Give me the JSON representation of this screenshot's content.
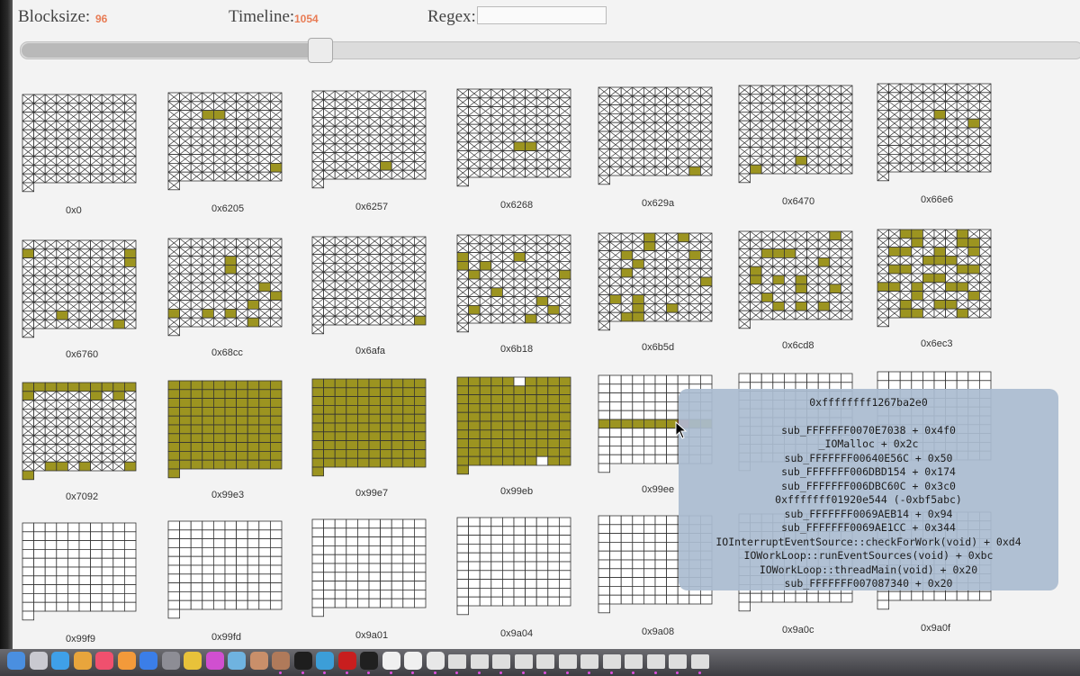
{
  "toolbar": {
    "blocksize_label": "Blocksize:",
    "blocksize_value": "96",
    "timeline_label": "Timeline:",
    "timeline_value": "1054",
    "regex_label": "Regex:",
    "regex_value": ""
  },
  "slider": {
    "position": 0.28
  },
  "colors": {
    "allocated": "#9c9420",
    "free": "#ffffff",
    "highlight": "#e04a2a",
    "grid_line": "#333333",
    "value_text": "#e87c55",
    "tooltip_bg": "#aabcd0"
  },
  "blocks": [
    {
      "label": "0x0",
      "state": "freed",
      "filled": [
        [
          3,
          10
        ]
      ]
    },
    {
      "label": "0x6205",
      "state": "freed",
      "filled": [
        [
          2,
          3
        ],
        [
          2,
          4
        ],
        [
          8,
          9
        ],
        [
          10,
          2
        ]
      ]
    },
    {
      "label": "0x6257",
      "state": "freed",
      "filled": [
        [
          8,
          6
        ]
      ]
    },
    {
      "label": "0x6268",
      "state": "freed",
      "filled": [
        [
          6,
          5
        ],
        [
          6,
          6
        ],
        [
          10,
          9
        ]
      ]
    },
    {
      "label": "0x629a",
      "state": "freed",
      "filled": [
        [
          9,
          8
        ],
        [
          10,
          3
        ]
      ]
    },
    {
      "label": "0x6470",
      "state": "freed",
      "filled": [
        [
          9,
          1
        ],
        [
          8,
          5
        ]
      ]
    },
    {
      "label": "0x66e6",
      "state": "freed",
      "filled": [
        [
          3,
          5
        ],
        [
          4,
          8
        ]
      ]
    },
    {
      "label": "0x6760",
      "state": "freed",
      "filled": [
        [
          1,
          0
        ],
        [
          1,
          9
        ],
        [
          2,
          9
        ],
        [
          8,
          3
        ],
        [
          9,
          8
        ]
      ]
    },
    {
      "label": "0x68cc",
      "state": "freed",
      "filled": [
        [
          2,
          5
        ],
        [
          3,
          5
        ],
        [
          5,
          8
        ],
        [
          6,
          9
        ],
        [
          7,
          7
        ],
        [
          8,
          0
        ],
        [
          8,
          3
        ],
        [
          8,
          5
        ],
        [
          9,
          7
        ]
      ]
    },
    {
      "label": "0x6afa",
      "state": "freed",
      "filled": [
        [
          9,
          9
        ]
      ]
    },
    {
      "label": "0x6b18",
      "state": "freed",
      "filled": [
        [
          2,
          0
        ],
        [
          3,
          0
        ],
        [
          3,
          2
        ],
        [
          4,
          1
        ],
        [
          2,
          5
        ],
        [
          6,
          3
        ],
        [
          7,
          7
        ],
        [
          8,
          8
        ],
        [
          8,
          1
        ],
        [
          9,
          6
        ],
        [
          4,
          9
        ]
      ]
    },
    {
      "label": "0x6b5d",
      "state": "freed",
      "filled": [
        [
          0,
          4
        ],
        [
          0,
          7
        ],
        [
          1,
          4
        ],
        [
          2,
          2
        ],
        [
          2,
          8
        ],
        [
          3,
          3
        ],
        [
          4,
          2
        ],
        [
          5,
          9
        ],
        [
          7,
          1
        ],
        [
          7,
          3
        ],
        [
          8,
          3
        ],
        [
          8,
          6
        ],
        [
          9,
          2
        ],
        [
          9,
          3
        ]
      ]
    },
    {
      "label": "0x6cd8",
      "state": "freed",
      "filled": [
        [
          0,
          8
        ],
        [
          2,
          2
        ],
        [
          2,
          3
        ],
        [
          2,
          4
        ],
        [
          3,
          7
        ],
        [
          4,
          1
        ],
        [
          5,
          1
        ],
        [
          5,
          5
        ],
        [
          6,
          5
        ],
        [
          6,
          8
        ],
        [
          7,
          2
        ],
        [
          8,
          3
        ],
        [
          8,
          5
        ],
        [
          8,
          7
        ],
        [
          5,
          3
        ]
      ]
    },
    {
      "label": "0x6ec3",
      "state": "freed",
      "filled": [
        [
          0,
          2
        ],
        [
          0,
          3
        ],
        [
          0,
          7
        ],
        [
          1,
          3
        ],
        [
          1,
          7
        ],
        [
          1,
          8
        ],
        [
          2,
          1
        ],
        [
          2,
          2
        ],
        [
          2,
          5
        ],
        [
          3,
          4
        ],
        [
          3,
          5
        ],
        [
          3,
          6
        ],
        [
          4,
          1
        ],
        [
          4,
          2
        ],
        [
          4,
          7
        ],
        [
          4,
          8
        ],
        [
          5,
          4
        ],
        [
          5,
          5
        ],
        [
          6,
          0
        ],
        [
          6,
          1
        ],
        [
          6,
          6
        ],
        [
          6,
          7
        ],
        [
          7,
          3
        ],
        [
          7,
          8
        ],
        [
          8,
          2
        ],
        [
          8,
          5
        ],
        [
          8,
          6
        ],
        [
          9,
          2
        ],
        [
          9,
          3
        ],
        [
          9,
          7
        ],
        [
          2,
          8
        ],
        [
          6,
          3
        ]
      ]
    },
    {
      "label": "0x7092",
      "state": "freed",
      "filled": [
        [
          0,
          0
        ],
        [
          0,
          1
        ],
        [
          0,
          2
        ],
        [
          0,
          3
        ],
        [
          0,
          4
        ],
        [
          0,
          5
        ],
        [
          0,
          6
        ],
        [
          0,
          7
        ],
        [
          0,
          8
        ],
        [
          0,
          9
        ],
        [
          1,
          0
        ],
        [
          1,
          6
        ],
        [
          1,
          8
        ],
        [
          9,
          2
        ],
        [
          9,
          3
        ],
        [
          9,
          9
        ],
        [
          10,
          0
        ],
        [
          10,
          1
        ],
        [
          9,
          5
        ]
      ]
    },
    {
      "label": "0x99e3",
      "state": "full",
      "filled": []
    },
    {
      "label": "0x99e7",
      "state": "full",
      "filled": []
    },
    {
      "label": "0x99eb",
      "state": "full",
      "holes": [
        [
          0,
          5
        ],
        [
          9,
          7
        ]
      ],
      "filled": []
    },
    {
      "label": "0x99ee",
      "state": "partial",
      "filled": [],
      "rows_filled": [
        5
      ],
      "highlight": [
        [
          5,
          7
        ]
      ]
    },
    {
      "label": "",
      "state": "empty",
      "filled": []
    },
    {
      "label": "",
      "state": "empty",
      "filled": []
    },
    {
      "label": "0x99f9",
      "state": "empty",
      "filled": []
    },
    {
      "label": "0x99fd",
      "state": "empty",
      "filled": []
    },
    {
      "label": "0x9a01",
      "state": "empty",
      "filled": []
    },
    {
      "label": "0x9a04",
      "state": "empty",
      "filled": []
    },
    {
      "label": "0x9a08",
      "state": "empty",
      "filled": []
    },
    {
      "label": "0x9a0c",
      "state": "empty",
      "filled": []
    },
    {
      "label": "0x9a0f",
      "state": "empty",
      "filled": []
    }
  ],
  "tooltip": {
    "title": "0xffffffff1267ba2e0",
    "lines": [
      "sub_FFFFFFF0070E7038 + 0x4f0",
      "_IOMalloc + 0x2c",
      "sub_FFFFFFF00640E56C + 0x50",
      "sub_FFFFFFF006DBD154 + 0x174",
      "sub_FFFFFFF006DBC60C + 0x3c0",
      "0xfffffff01920e544 (-0xbf5abc)",
      "sub_FFFFFFF0069AEB14 + 0x94",
      "sub_FFFFFFF0069AE1CC + 0x344",
      "IOInterruptEventSource::checkForWork(void) + 0xd4",
      "IOWorkLoop::runEventSources(void) + 0xbc",
      "IOWorkLoop::threadMain(void) + 0x20",
      "sub_FFFFFFF007087340 + 0x20"
    ]
  },
  "dock": {
    "icons": [
      "finder-icon",
      "launchpad-icon",
      "safari-icon",
      "photos-icon",
      "music-icon",
      "books-icon",
      "app-store-icon",
      "settings-icon",
      "chrome-icon",
      "flower-icon",
      "preview-icon",
      "avatar-icon",
      "avatar-icon",
      "terminal-icon",
      "xcode-icon",
      "debug-icon",
      "activity-icon",
      "doc-icon",
      "doc-icon",
      "doc-icon",
      "thumb-icon",
      "thumb-icon",
      "thumb-icon",
      "thumb-icon",
      "thumb-icon",
      "thumb-icon",
      "thumb-icon",
      "thumb-icon",
      "thumb-icon",
      "thumb-icon",
      "thumb-icon",
      "thumb-icon"
    ]
  }
}
